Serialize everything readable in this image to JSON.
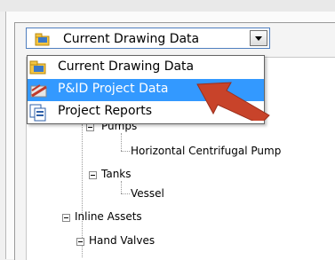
{
  "combo": {
    "selected": "Current Drawing Data"
  },
  "dropdown": {
    "options": [
      {
        "label": "Current Drawing Data",
        "icon": "drawing-data-icon"
      },
      {
        "label": "P&ID Project Data",
        "icon": "pid-project-icon",
        "highlighted": true
      },
      {
        "label": "Project Reports",
        "icon": "reports-icon"
      }
    ]
  },
  "tree": {
    "pumps": "Pumps",
    "horizontal_pump": "Horizontal Centrifugal Pump",
    "tanks": "Tanks",
    "vessel": "Vessel",
    "inline_assets": "Inline Assets",
    "hand_valves": "Hand Valves"
  },
  "colors": {
    "highlight": "#3399ff",
    "arrow": "#c8432a"
  }
}
